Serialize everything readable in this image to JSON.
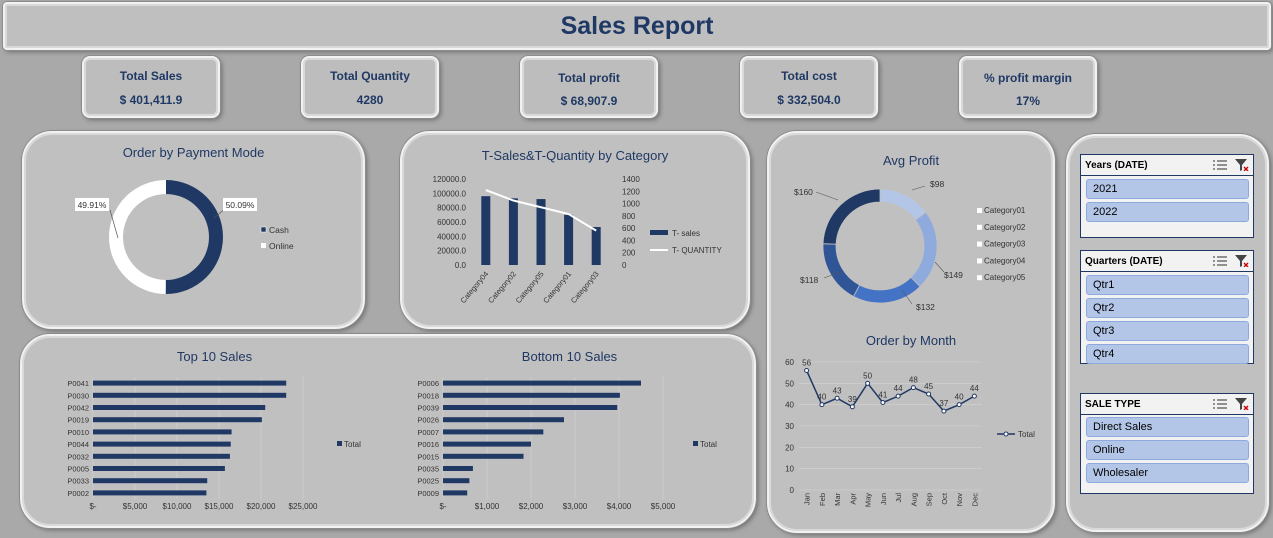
{
  "title": "Sales Report",
  "kpis": [
    {
      "label": "Total Sales",
      "value": "$ 401,411.9"
    },
    {
      "label": "Total Quantity",
      "value": "4280"
    },
    {
      "label": "Total profit",
      "value": "$ 68,907.9"
    },
    {
      "label": "Total cost",
      "value": "$ 332,504.0"
    },
    {
      "label": "% profit margin",
      "value": "17%"
    }
  ],
  "colors": {
    "navy": "#203864",
    "mid_blue": "#4472c4",
    "light_blue": "#8faadc",
    "pale_blue": "#b4c6e7"
  },
  "chart_data": [
    {
      "type": "pie",
      "title": "Order by Payment Mode",
      "categories": [
        "Cash",
        "Online"
      ],
      "values": [
        50.09,
        49.91
      ],
      "labels": [
        "50.09%",
        "49.91%"
      ],
      "legend": "right"
    },
    {
      "type": "bar",
      "title": "T-Sales&T-Quantity by Category",
      "categories": [
        "Category04",
        "Category02",
        "Category05",
        "Category01",
        "Category03"
      ],
      "series": [
        {
          "name": "T- sales",
          "values": [
            96000,
            93000,
            92000,
            70000,
            53000
          ]
        },
        {
          "name": "T- QUANTITY",
          "values": [
            1220,
            1050,
            940,
            830,
            560
          ]
        }
      ],
      "y_ticks": [
        "120000.0",
        "100000.0",
        "80000.0",
        "60000.0",
        "40000.0",
        "20000.0",
        "0.0"
      ],
      "y2_ticks": [
        "1400",
        "1200",
        "1000",
        "800",
        "600",
        "400",
        "200",
        "0"
      ],
      "ylim": [
        0,
        120000
      ],
      "y2lim": [
        0,
        1400
      ],
      "legend": "right"
    },
    {
      "type": "pie",
      "title": "Avg Profit",
      "categories": [
        "Category01",
        "Category02",
        "Category03",
        "Category04",
        "Category05"
      ],
      "values": [
        98,
        149,
        132,
        118,
        160
      ],
      "labels": [
        "$98",
        "$149",
        "$132",
        "$118",
        "$160"
      ],
      "legend": "right"
    },
    {
      "type": "line",
      "title": "Order by Month",
      "categories": [
        "Jan",
        "Feb",
        "Mar",
        "Apr",
        "May",
        "Jun",
        "Jul",
        "Aug",
        "Sep",
        "Oct",
        "Nov",
        "Dec"
      ],
      "series": [
        {
          "name": "Total",
          "values": [
            56,
            40,
            43,
            39,
            50,
            41,
            44,
            48,
            45,
            37,
            40,
            44
          ]
        }
      ],
      "y_ticks": [
        "60",
        "50",
        "40",
        "30",
        "20",
        "10",
        "0"
      ],
      "ylim": [
        0,
        60
      ],
      "legend": "right"
    },
    {
      "type": "bar",
      "title": "Top 10 Sales",
      "categories": [
        "P0041",
        "P0030",
        "P0042",
        "P0019",
        "P0010",
        "P0044",
        "P0032",
        "P0005",
        "P0033",
        "P0002"
      ],
      "series": [
        {
          "name": "Total",
          "values": [
            23000,
            23000,
            20500,
            20100,
            16500,
            16400,
            16300,
            15700,
            13600,
            13500
          ]
        }
      ],
      "x_ticks": [
        "$-",
        "$5,000",
        "$10,000",
        "$15,000",
        "$20,000",
        "$25,000"
      ],
      "xlim": [
        0,
        25000
      ],
      "legend": "right"
    },
    {
      "type": "bar",
      "title": "Bottom 10 Sales",
      "categories": [
        "P0006",
        "P0018",
        "P0039",
        "P0026",
        "P0007",
        "P0016",
        "P0015",
        "P0035",
        "P0025",
        "P0009"
      ],
      "series": [
        {
          "name": "Total",
          "values": [
            4500,
            4020,
            3960,
            2750,
            2280,
            2000,
            1830,
            680,
            600,
            550
          ]
        }
      ],
      "x_ticks": [
        "$-",
        "$1,000",
        "$2,000",
        "$3,000",
        "$4,000",
        "$5,000"
      ],
      "xlim": [
        0,
        5000
      ],
      "legend": "right"
    }
  ],
  "slicers": [
    {
      "title": "Years (DATE)",
      "items": [
        "2021",
        "2022"
      ]
    },
    {
      "title": "Quarters (DATE)",
      "items": [
        "Qtr1",
        "Qtr2",
        "Qtr3",
        "Qtr4"
      ]
    },
    {
      "title": "SALE TYPE",
      "items": [
        "Direct Sales",
        "Online",
        "Wholesaler"
      ]
    }
  ],
  "icons": {
    "multi_select": "multi-select-icon",
    "clear_filter": "clear-filter-icon"
  }
}
